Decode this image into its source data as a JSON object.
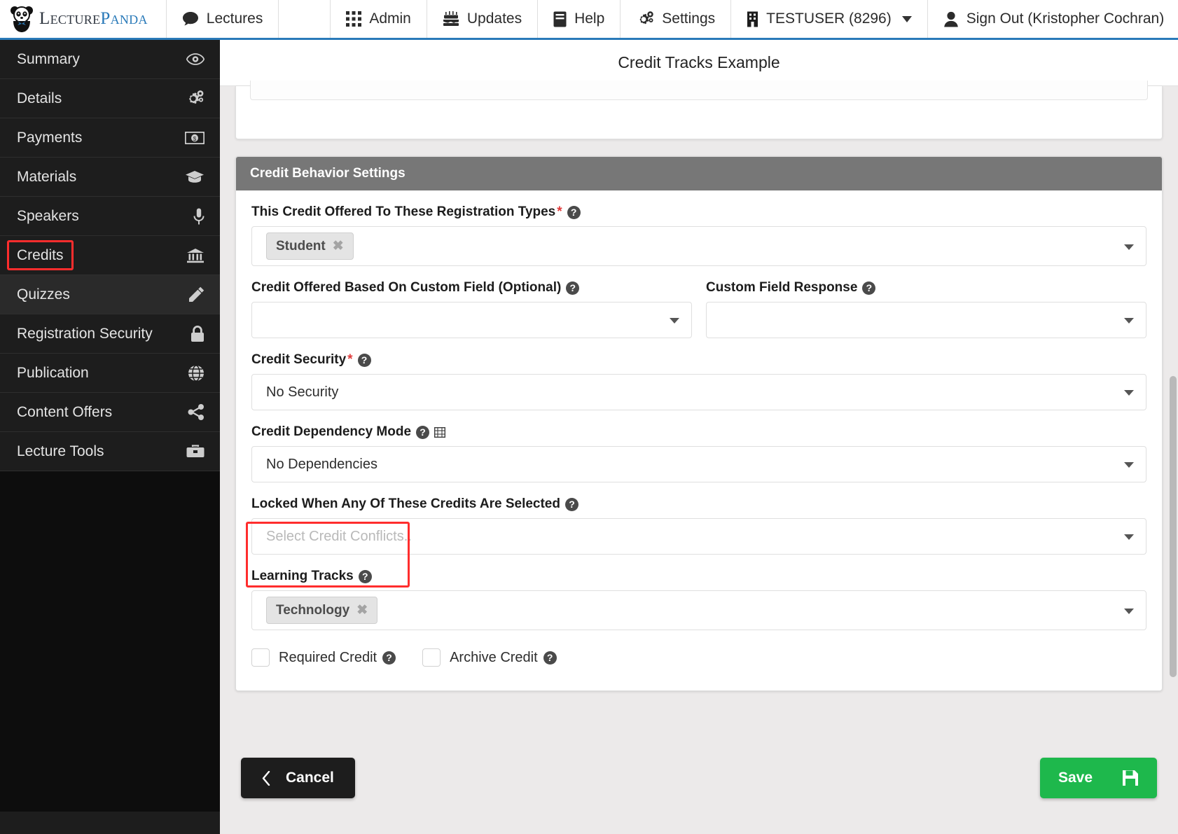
{
  "brand": {
    "lecture": "Lecture",
    "panda": "Panda",
    "icon": "panda-logo-icon"
  },
  "topnav": {
    "items": [
      {
        "label": "Lectures",
        "icon": "comment-icon"
      },
      {
        "label": "Admin",
        "icon": "grid-apps-icon"
      },
      {
        "label": "Updates",
        "icon": "cake-icon"
      },
      {
        "label": "Help",
        "icon": "book-icon"
      },
      {
        "label": "Settings",
        "icon": "gears-icon"
      },
      {
        "label": "TESTUSER (8296)",
        "icon": "building-icon"
      },
      {
        "label": "Sign Out (Kristopher Cochran)",
        "icon": "user-icon"
      }
    ]
  },
  "sidebar": {
    "items": [
      {
        "label": "Summary",
        "icon": "eye-icon"
      },
      {
        "label": "Details",
        "icon": "gears-icon"
      },
      {
        "label": "Payments",
        "icon": "money-bill-icon"
      },
      {
        "label": "Materials",
        "icon": "graduation-cap-icon"
      },
      {
        "label": "Speakers",
        "icon": "microphone-icon"
      },
      {
        "label": "Credits",
        "icon": "university-icon"
      },
      {
        "label": "Quizzes",
        "icon": "pencil-icon"
      },
      {
        "label": "Registration Security",
        "icon": "lock-icon"
      },
      {
        "label": "Publication",
        "icon": "globe-icon"
      },
      {
        "label": "Content Offers",
        "icon": "share-icon"
      },
      {
        "label": "Lecture Tools",
        "icon": "toolbox-icon"
      }
    ]
  },
  "page": {
    "title": "Credit Tracks Example"
  },
  "panel": {
    "title": "Credit Behavior Settings",
    "fields": {
      "registration_types": {
        "label": "This Credit Offered To These Registration Types",
        "required": "*",
        "chips": [
          {
            "label": "Student",
            "remove": "✖"
          }
        ]
      },
      "custom_field": {
        "label": "Credit Offered Based On Custom Field (Optional)",
        "value": ""
      },
      "custom_field_response": {
        "label": "Custom Field Response",
        "value": ""
      },
      "credit_security": {
        "label": "Credit Security",
        "required": "*",
        "value": "No Security"
      },
      "dependency_mode": {
        "label": "Credit Dependency Mode",
        "value": "No Dependencies",
        "extra_icon": "film-video-icon"
      },
      "credit_conflicts": {
        "label": "Locked When Any Of These Credits Are Selected",
        "placeholder": "Select Credit Conflicts.."
      },
      "learning_tracks": {
        "label": "Learning Tracks",
        "chips": [
          {
            "label": "Technology",
            "remove": "✖"
          }
        ]
      },
      "required_credit": {
        "label": "Required Credit",
        "checked": false
      },
      "archive_credit": {
        "label": "Archive Credit",
        "checked": false
      }
    },
    "help_glyph": "?"
  },
  "footer": {
    "cancel_label": "Cancel",
    "save_label": "Save"
  },
  "colors": {
    "accent_blue": "#2a7ab9",
    "panel_header_gray": "#777777",
    "save_green": "#1eb84c",
    "annotation_red": "#ff2d2d",
    "sidebar_dark": "#1d1d1d"
  }
}
